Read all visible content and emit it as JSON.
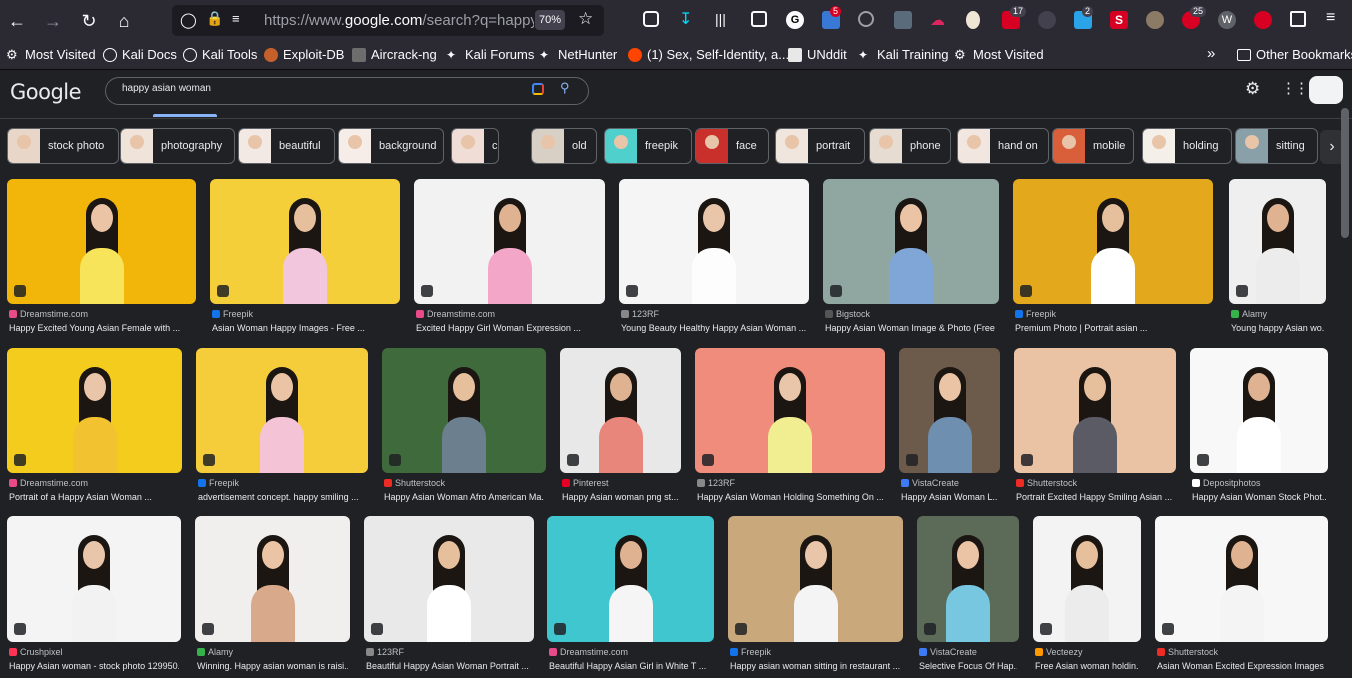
{
  "browser": {
    "url_prefix": "https://www.",
    "url_domain": "google.com",
    "url_rest": "/search?q=happy+",
    "zoom": "70%",
    "badges": {
      "ext1": "5",
      "ext2": "17",
      "ext3": "2",
      "ext4": "25"
    }
  },
  "bookmarks": [
    "Most Visited",
    "Kali Docs",
    "Kali Tools",
    "Exploit-DB",
    "Aircrack-ng",
    "Kali Forums",
    "NetHunter",
    "(1) Sex, Self-Identity, a...",
    "UNddit",
    "Kali Training",
    "Most Visited"
  ],
  "other_bookmarks": "Other Bookmarks",
  "google": {
    "logo": "Google",
    "query": "happy asian woman"
  },
  "chips": [
    "stock photo",
    "photography",
    "beautiful",
    "background",
    "cute",
    "old",
    "freepik",
    "face",
    "portrait",
    "phone",
    "hand on",
    "mobile",
    "holding",
    "sitting"
  ],
  "results": [
    [
      {
        "source": "Dreamstime.com",
        "caption": "Happy Excited Young Asian Female with ..."
      },
      {
        "source": "Freepik",
        "caption": "Asian Woman Happy Images - Free ..."
      },
      {
        "source": "Dreamstime.com",
        "caption": "Excited Happy Girl Woman Expression ..."
      },
      {
        "source": "123RF",
        "caption": "Young Beauty Healthy Happy Asian Woman ..."
      },
      {
        "source": "Bigstock",
        "caption": "Happy Asian Woman Image & Photo (Free ..."
      },
      {
        "source": "Freepik",
        "caption": "Premium Photo | Portrait asian ..."
      },
      {
        "source": "Alamy",
        "caption": "Young happy Asian wo..."
      }
    ],
    [
      {
        "source": "Dreamstime.com",
        "caption": "Portrait of a Happy Asian Woman ..."
      },
      {
        "source": "Freepik",
        "caption": "advertisement concept. happy smiling ..."
      },
      {
        "source": "Shutterstock",
        "caption": "Happy Asian Woman Afro American Ma..."
      },
      {
        "source": "Pinterest",
        "caption": "Happy Asian woman png st..."
      },
      {
        "source": "123RF",
        "caption": "Happy Asian Woman Holding Something On ..."
      },
      {
        "source": "VistaCreate",
        "caption": "Happy Asian Woman L..."
      },
      {
        "source": "Shutterstock",
        "caption": "Portrait Excited Happy Smiling Asian ..."
      },
      {
        "source": "Depositphotos",
        "caption": "Happy Asian Woman Stock Phot..."
      }
    ],
    [
      {
        "source": "Crushpixel",
        "caption": "Happy Asian woman - stock photo 129950..."
      },
      {
        "source": "Alamy",
        "caption": "Winning. Happy asian woman is raisi..."
      },
      {
        "source": "123RF",
        "caption": "Beautiful Happy Asian Woman Portrait ..."
      },
      {
        "source": "Dreamstime.com",
        "caption": "Beautiful Happy Asian Girl in White T ..."
      },
      {
        "source": "Freepik",
        "caption": "Happy asian woman sitting in restaurant ..."
      },
      {
        "source": "VistaCreate",
        "caption": "Selective Focus Of Hap..."
      },
      {
        "source": "Vecteezy",
        "caption": "Free Asian woman holdin..."
      },
      {
        "source": "Shutterstock",
        "caption": "Asian Woman Excited Expression Images ..."
      }
    ]
  ],
  "colors": {
    "accent": "#8ab4f8",
    "bg": "#202124"
  }
}
